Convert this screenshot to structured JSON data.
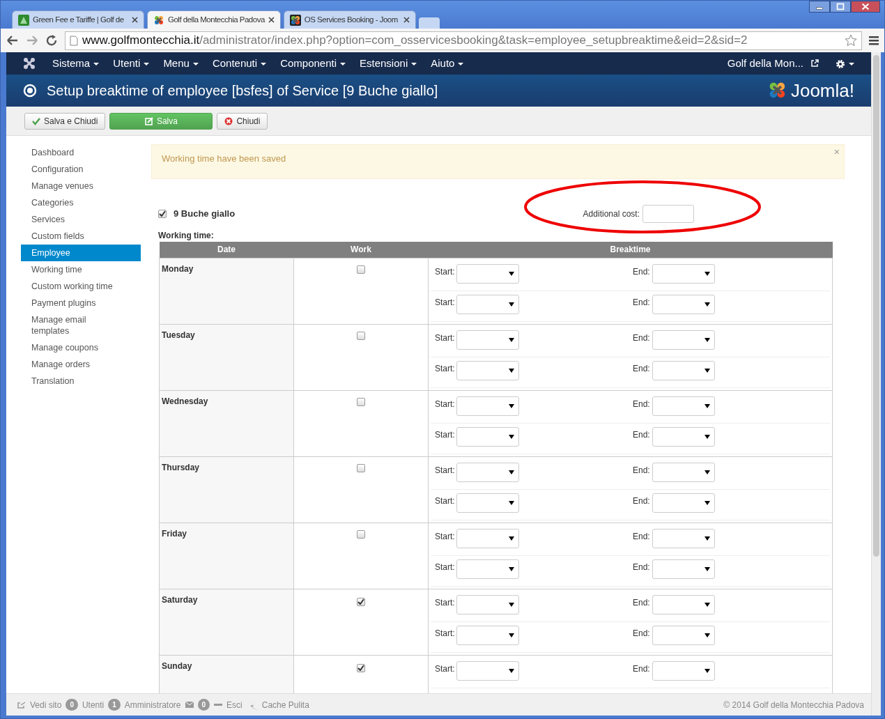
{
  "browser": {
    "tabs": [
      {
        "title": "Green Fee e Tariffe | Golf de",
        "selected": false,
        "kind": "green"
      },
      {
        "title": "Golf della Montecchia Padova",
        "selected": true,
        "kind": "joomla"
      },
      {
        "title": "OS Services Booking - Joom",
        "selected": false,
        "kind": "dark"
      }
    ],
    "url_host": "www.golfmontecchia.it",
    "url_path": "/administrator/index.php?option=com_osservicesbooking&task=employee_setupbreaktime&eid=2&sid=2"
  },
  "navbar": {
    "menus": [
      "Sistema",
      "Utenti",
      "Menu",
      "Contenuti",
      "Componenti",
      "Estensioni",
      "Aiuto"
    ],
    "site_link": "Golf della Mon..."
  },
  "header": {
    "title": "Setup breaktime of employee [bsfes] of Service [9 Buche giallo]",
    "logo_text": "Joomla!"
  },
  "toolbar": [
    {
      "label": "Salva e Chiudi",
      "kind": "check"
    },
    {
      "label": "Salva",
      "kind": "save"
    },
    {
      "label": "Chiudi",
      "kind": "close"
    }
  ],
  "sidebar": {
    "items": [
      {
        "label": "Dashboard",
        "selected": false
      },
      {
        "label": "Configuration",
        "selected": false
      },
      {
        "label": "Manage venues",
        "selected": false
      },
      {
        "label": "Categories",
        "selected": false
      },
      {
        "label": "Services",
        "selected": false
      },
      {
        "label": "Custom fields",
        "selected": false
      },
      {
        "label": "Employee",
        "selected": true
      },
      {
        "label": "Working time",
        "selected": false
      },
      {
        "label": "Custom working time",
        "selected": false
      },
      {
        "label": "Payment plugins",
        "selected": false
      },
      {
        "label": "Manage email templates",
        "selected": false
      },
      {
        "label": "Manage coupons",
        "selected": false
      },
      {
        "label": "Manage orders",
        "selected": false
      },
      {
        "label": "Translation",
        "selected": false
      }
    ]
  },
  "alert": {
    "message": "Working time have been saved",
    "close": "×"
  },
  "service": {
    "name": "9 Buche giallo",
    "checked": true,
    "additional_cost_label": "Additional cost:"
  },
  "working_time_label": "Working time:",
  "table": {
    "columns": [
      "Date",
      "Work",
      "Breaktime"
    ],
    "rows": [
      {
        "day": "Monday",
        "work": false,
        "breaks": [
          {
            "start": "Start:",
            "end": "End:"
          },
          {
            "start": "Start:",
            "end": "End:"
          }
        ]
      },
      {
        "day": "Tuesday",
        "work": false,
        "breaks": [
          {
            "start": "Start:",
            "end": "End:"
          },
          {
            "start": "Start:",
            "end": "End:"
          }
        ]
      },
      {
        "day": "Wednesday",
        "work": false,
        "breaks": [
          {
            "start": "Start:",
            "end": "End:"
          },
          {
            "start": "Start:",
            "end": "End:"
          }
        ]
      },
      {
        "day": "Thursday",
        "work": false,
        "breaks": [
          {
            "start": "Start:",
            "end": "End:"
          },
          {
            "start": "Start:",
            "end": "End:"
          }
        ]
      },
      {
        "day": "Friday",
        "work": false,
        "breaks": [
          {
            "start": "Start:",
            "end": "End:"
          },
          {
            "start": "Start:",
            "end": "End:"
          }
        ]
      },
      {
        "day": "Saturday",
        "work": true,
        "breaks": [
          {
            "start": "Start:",
            "end": "End:"
          },
          {
            "start": "Start:",
            "end": "End:"
          }
        ]
      },
      {
        "day": "Sunday",
        "work": true,
        "breaks": [
          {
            "start": "Start:",
            "end": "End:"
          }
        ]
      }
    ]
  },
  "status_bar": {
    "items": [
      {
        "kind": "link",
        "label": "Vedi sito"
      },
      {
        "kind": "badge",
        "count": "0",
        "label": "Utenti"
      },
      {
        "kind": "badge",
        "count": "1",
        "label": "Amministratore"
      },
      {
        "kind": "mail",
        "count": "0"
      },
      {
        "kind": "logout",
        "label": "Esci"
      },
      {
        "kind": "cache",
        "label": "Cache Pulita"
      }
    ],
    "copyright": "© 2014 Golf della Montecchia Padova"
  }
}
